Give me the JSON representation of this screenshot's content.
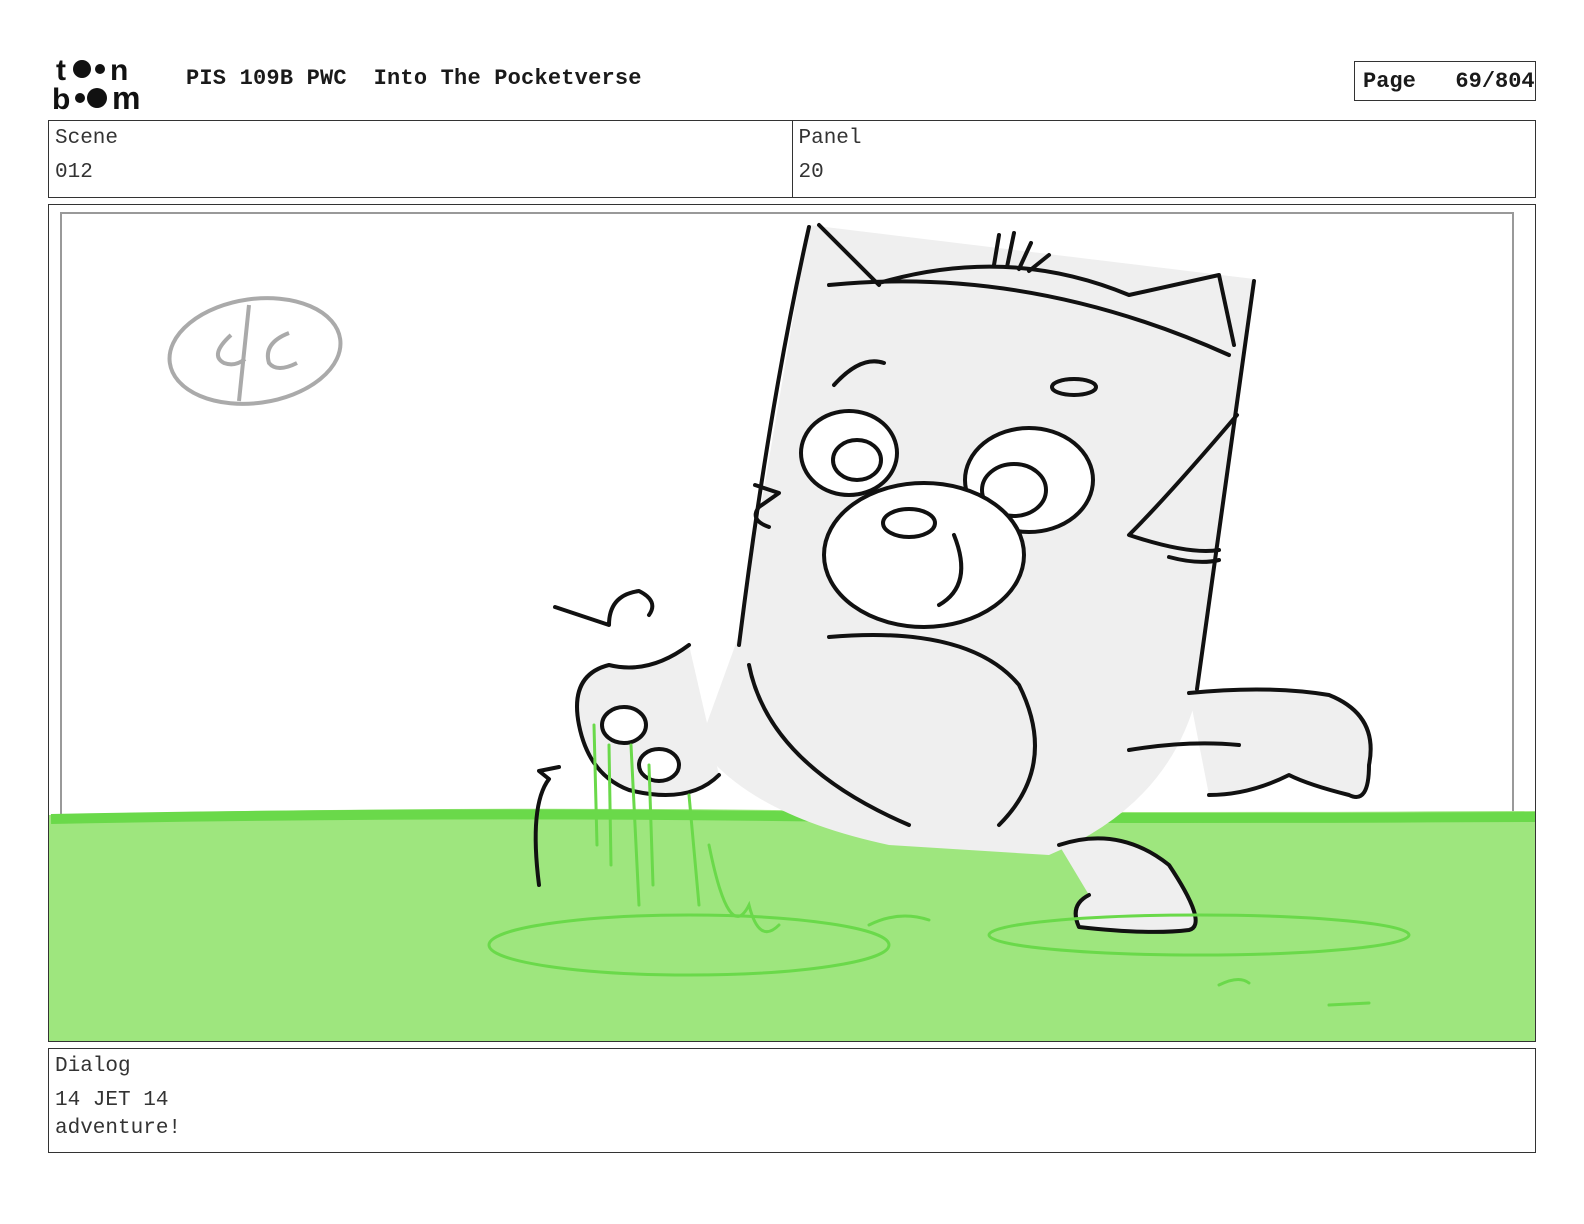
{
  "header": {
    "logo_text": "toonboom",
    "title": "PIS 109B PWC  Into The Pocketverse",
    "page_label": "Page",
    "page_number": "69/804"
  },
  "scene": {
    "label": "Scene",
    "value": "012"
  },
  "panel": {
    "label": "Panel",
    "value": "20"
  },
  "artwork": {
    "description_icon": "storyboard-sketch",
    "ground_color": "#9ee67e",
    "ground_line_color": "#6ad94a",
    "sketch_fill": "#efefef"
  },
  "dialog": {
    "label": "Dialog",
    "line1": "14 JET 14",
    "line2": "adventure!"
  }
}
